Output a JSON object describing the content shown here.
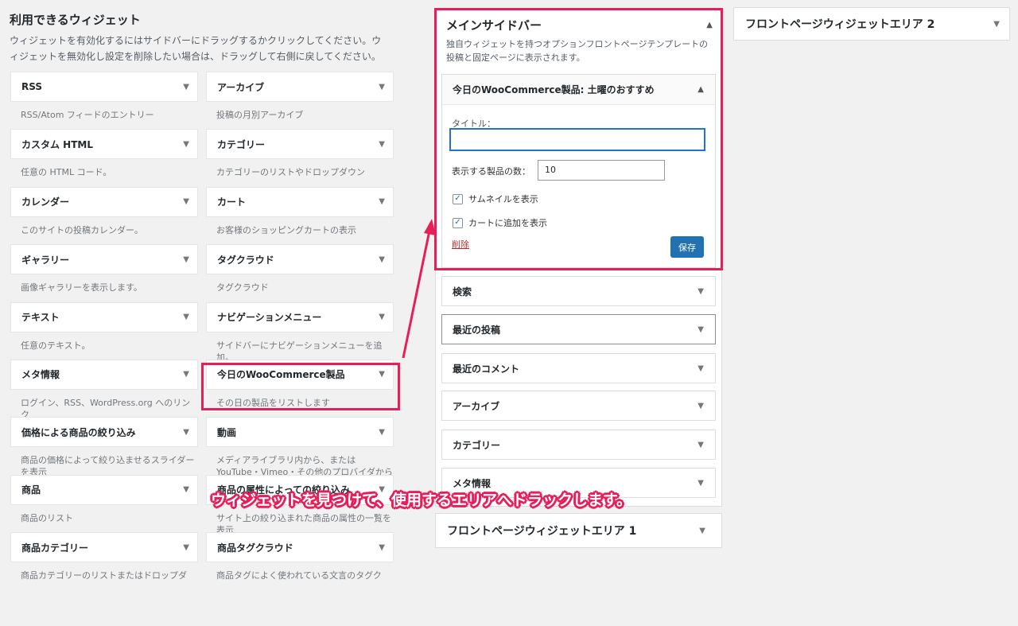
{
  "available": {
    "title": "利用できるウィジェット",
    "description": "ウィジェットを有効化するにはサイドバーにドラッグするかクリックしてください。ウィジェットを無効化し設定を削除したい場合は、ドラッグして右側に戻してください。",
    "widgets": [
      {
        "name": "RSS",
        "desc": "RSS/Atom フィードのエントリー"
      },
      {
        "name": "アーカイブ",
        "desc": "投稿の月別アーカイブ"
      },
      {
        "name": "カスタム HTML",
        "desc": "任意の HTML コード。"
      },
      {
        "name": "カテゴリー",
        "desc": "カテゴリーのリストやドロップダウン"
      },
      {
        "name": "カレンダー",
        "desc": "このサイトの投稿カレンダー。"
      },
      {
        "name": "カート",
        "desc": "お客様のショッピングカートの表示"
      },
      {
        "name": "ギャラリー",
        "desc": "画像ギャラリーを表示します。"
      },
      {
        "name": "タグクラウド",
        "desc": "タグクラウド"
      },
      {
        "name": "テキスト",
        "desc": "任意のテキスト。"
      },
      {
        "name": "ナビゲーションメニュー",
        "desc": "サイドバーにナビゲーションメニューを追加。"
      },
      {
        "name": "メタ情報",
        "desc": "ログイン、RSS、WordPress.org へのリンク"
      },
      {
        "name": "今日のWooCommerce製品",
        "desc": "その日の製品をリストします"
      },
      {
        "name": "価格による商品の絞り込み",
        "desc": "商品の価格によって絞り込ませるスライダーを表示"
      },
      {
        "name": "動画",
        "desc": "メディアライブラリ内から、または YouTube・Vimeo・その他のプロバイダから"
      },
      {
        "name": "商品",
        "desc": "商品のリスト"
      },
      {
        "name": "商品の属性によっての絞り込み",
        "desc": "サイト上の絞り込まれた商品の属性の一覧を表示"
      },
      {
        "name": "商品カテゴリー",
        "desc": "商品カテゴリーのリストまたはドロップダ"
      },
      {
        "name": "商品タグクラウド",
        "desc": "商品タグによく使われている文言のタグク"
      }
    ]
  },
  "sidebar": {
    "title": "メインサイドバー",
    "description": "独自ウィジェットを持つオプションフロントページテンプレートの投稿と固定ページに表示されます。",
    "open_widget": {
      "title": "今日のWooCommerce製品: 土曜のおすすめ",
      "title_label": "タイトル：",
      "title_value": "",
      "count_label": "表示する製品の数：",
      "count_value": "10",
      "show_thumbnail": "サムネイルを表示",
      "show_add_to_cart": "カートに追加を表示",
      "delete": "削除",
      "save": "保存"
    },
    "items": [
      "検索",
      "最近の投稿",
      "最近のコメント",
      "アーカイブ",
      "カテゴリー",
      "メタ情報"
    ]
  },
  "areas": {
    "front1": "フロントページウィジェットエリア 1",
    "front2": "フロントページウィジェットエリア 2"
  },
  "annotation": {
    "callout": "ウィジェットを見つけて、使用するエリアへドラックします。",
    "color": "#e61e5a"
  },
  "icons": {
    "caret_down": "▼",
    "caret_up": "▲",
    "check": "✓"
  }
}
